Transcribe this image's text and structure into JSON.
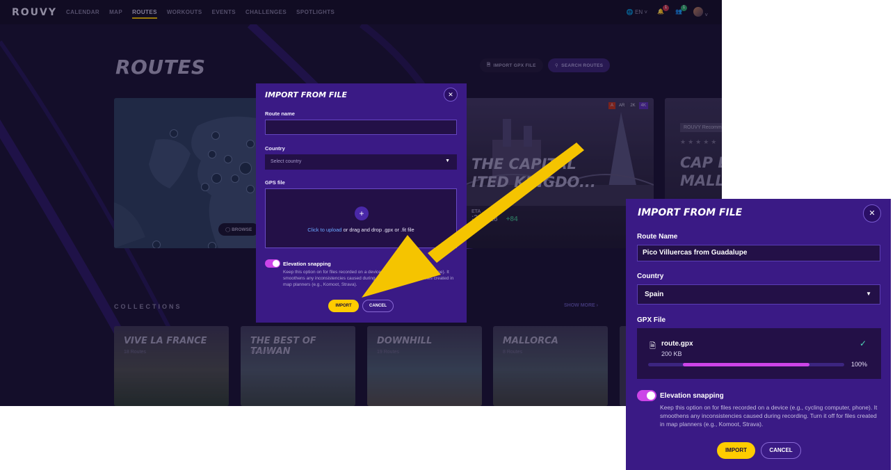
{
  "app": {
    "logo": "ROUVY",
    "nav": [
      "CALENDAR",
      "MAP",
      "ROUTES",
      "WORKOUTS",
      "EVENTS",
      "CHALLENGES",
      "SPOTLIGHTS"
    ],
    "active_nav": "ROUTES",
    "language": "EN",
    "notification_count": "1",
    "friends_count": "1",
    "accent_color": "#e6b800"
  },
  "page": {
    "title": "ROUTES",
    "import_gpx_label": "IMPORT GPX FILE",
    "search_routes_label": "SEARCH ROUTES",
    "browse_label": "BROWSE",
    "featured_route": {
      "title_line1": "THE CAPITAL",
      "title_line2": "ITED KINGDO...",
      "badges": [
        "A",
        "AR",
        "2K",
        "4K"
      ],
      "stat_eta": "ETA",
      "stat_time": ":29",
      "stat_distance": "18",
      "stat_points": "+84"
    },
    "second_route": {
      "recommended": "ROUVY Recomm",
      "title_line1": "CAP DE",
      "title_line2": "MALLO"
    },
    "collections_heading": "COLLECTIONS",
    "show_more": "SHOW MORE",
    "collections": [
      {
        "title": "VIVE LA FRANCE",
        "count": "18 Routes"
      },
      {
        "title": "THE BEST OF TAIWAN",
        "count": "15 Routes"
      },
      {
        "title": "DOWNHILL",
        "count": "19 Routes"
      },
      {
        "title": "MALLORCA",
        "count": "8 Routes"
      }
    ],
    "map_clusters": [
      "6",
      "3",
      "8",
      "13",
      "3",
      "6",
      "20",
      "14",
      "7",
      "6",
      "6",
      "4",
      "3",
      "122",
      "3",
      "2",
      "2",
      "4"
    ]
  },
  "modal_small": {
    "title": "IMPORT FROM FILE",
    "route_name_label": "Route name",
    "route_name_value": "",
    "country_label": "Country",
    "country_placeholder": "Select country",
    "gps_label": "GPS file",
    "drop_link": "Click to upload",
    "drop_text": " or drag and drop .gpx or .fit file",
    "snapping_label": "Elevation snapping",
    "snapping_desc": "Keep this option on for files recorded on a device (e.g., cycling computer, phone). It smoothens any inconsistencies caused during recording. Turn it off for files created in map planners (e.g., Komoot, Strava).",
    "import_label": "IMPORT",
    "cancel_label": "CANCEL"
  },
  "modal_big": {
    "title": "IMPORT FROM FILE",
    "route_name_label": "Route Name",
    "route_name_value": "Pico Villuercas from Guadalupe",
    "country_label": "Country",
    "country_value": "Spain",
    "gpx_label": "GPX File",
    "file_name": "route.gpx",
    "file_size": "200 KB",
    "progress_percent": 100,
    "progress_text": "100%",
    "snapping_label": "Elevation snapping",
    "snapping_desc": "Keep this option on for files recorded on a device (e.g., cycling computer, phone). It smoothens any inconsistencies caused during recording. Turn it off for files created in map planners (e.g., Komoot, Strava).",
    "import_label": "IMPORT",
    "cancel_label": "CANCEL",
    "toggle_color": "#cc44e8",
    "import_color": "#ffcc00"
  }
}
